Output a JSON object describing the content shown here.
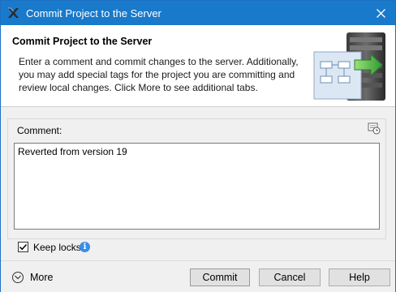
{
  "window": {
    "title": "Commit Project to the Server",
    "accent": "#1979ca"
  },
  "header": {
    "title": "Commit Project to the Server",
    "description": "Enter a comment and commit changes to the server. Additionally, you may add special tags for the project you are committing and review local changes. Click More to see additional tabs."
  },
  "comment": {
    "label": "Comment:",
    "value": "Reverted from version 19",
    "history_icon": "history-icon"
  },
  "keep_locks": {
    "label": "Keep locks",
    "checked": true,
    "info_icon": "info-icon"
  },
  "footer": {
    "more_label": "More",
    "commit_label": "Commit",
    "cancel_label": "Cancel",
    "help_label": "Help"
  }
}
